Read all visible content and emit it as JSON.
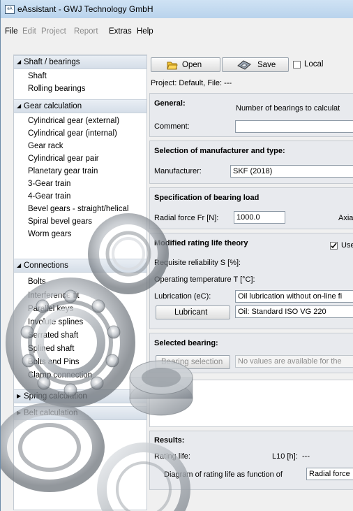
{
  "window": {
    "title": "eAssistant - GWJ Technology GmbH",
    "icon_text": "eA"
  },
  "menu": {
    "file": "File",
    "edit": "Edit",
    "project": "Project",
    "report": "Report",
    "extras": "Extras",
    "help": "Help"
  },
  "sidebar": {
    "shaft_bearings": {
      "label": "Shaft / bearings",
      "items": [
        "Shaft",
        "Rolling bearings"
      ]
    },
    "gear_calculation": {
      "label": "Gear calculation",
      "items": [
        "Cylindrical gear (external)",
        "Cylindrical gear (internal)",
        "Gear rack",
        "Cylindrical gear pair",
        "Planetary gear train",
        "3-Gear train",
        "4-Gear train",
        "Bevel gears - straight/helical",
        "Spiral bevel gears",
        "Worm gears"
      ]
    },
    "connections": {
      "label": "Connections",
      "items": [
        "Bolts",
        "Interference fit",
        "Parallel keys",
        "Involute splines",
        "Serrated shaft",
        "Splined shaft",
        "Bolts and Pins",
        "Clamp connection"
      ]
    },
    "spring_calculation": {
      "label": "Spring calculation"
    },
    "belt_calculation": {
      "label": "Belt calculation"
    }
  },
  "toolbar": {
    "open": "Open",
    "save": "Save",
    "local": "Local"
  },
  "project_line": "Project: Default, File: ---",
  "general": {
    "title": "General:",
    "bearings_text": "Number of bearings to calculat",
    "comment_label": "Comment:",
    "comment_value": ""
  },
  "manufacturer": {
    "title": "Selection of manufacturer and type:",
    "label": "Manufacturer:",
    "value": "SKF (2018)"
  },
  "load": {
    "title": "Specification of bearing load",
    "radial_label": "Radial force Fr [N]:",
    "radial_value": "1000.0",
    "axial_label": "Axial"
  },
  "modified": {
    "title": "Modified rating life theory",
    "use_label": "Use",
    "reliability_label": "Requisite reliability S [%]:",
    "temperature_label": "Operating temperature T [°C]:",
    "lubrication_label": "Lubrication (eC):",
    "lubrication_value": "Oil lubrication without on-line fi",
    "lubricant_button": "Lubricant",
    "oil_value": "Oil:  Standard ISO VG 220"
  },
  "selected": {
    "title": "Selected bearing:",
    "button": "Bearing selection",
    "value": "No values are available for the"
  },
  "results": {
    "title": "Results:",
    "rating_label": "Rating life:",
    "l10_label": "L10 [h]:",
    "l10_value": "---",
    "diagram_label": "Diagram of rating life as function of",
    "diagram_value": "Radial force"
  },
  "colors": {
    "accent": "#1f5fa8",
    "panel": "#e8eaee",
    "sidebar_header": "#dce4ec"
  }
}
